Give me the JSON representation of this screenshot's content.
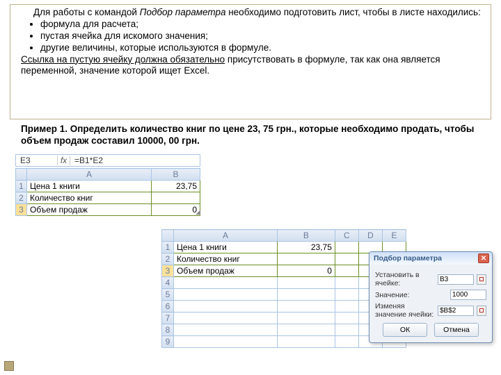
{
  "text": {
    "para1a": "Для работы с командой ",
    "para1b": "Подбор параметра",
    "para1c": " необходимо подготовить лист, чтобы в листе находились:",
    "b1": "формула для расчета;",
    "b2": "пустая ячейка для искомого значения;",
    "b3": "другие величины, которые используются в формуле.",
    "para2a": "Ссылка на пустую ячейку должна обязательно",
    "para2b": " присутствовать в формуле, так как она является переменной, значение которой ищет Excel.",
    "example": "Пример 1. Определить количество книг по цене 23, 75 грн., которые необходимо продать, чтобы объем продаж составил 10000, 00 грн."
  },
  "sheet1": {
    "activeCell": "E3",
    "formula": "=B1*E2",
    "cols": {
      "A": "A",
      "B": "B"
    },
    "rows": [
      {
        "n": "1",
        "a": "Цена 1 книги",
        "b": "23,75"
      },
      {
        "n": "2",
        "a": "Количество книг",
        "b": ""
      },
      {
        "n": "3",
        "a": "Объем продаж",
        "b": "0"
      }
    ]
  },
  "sheet2": {
    "cols": [
      "A",
      "B",
      "C",
      "D",
      "E"
    ],
    "rows": [
      {
        "n": "1",
        "a": "Цена 1 книги",
        "b": "23,75"
      },
      {
        "n": "2",
        "a": "Количество книг",
        "b": ""
      },
      {
        "n": "3",
        "a": "Объем продаж",
        "b": "0"
      },
      {
        "n": "4"
      },
      {
        "n": "5"
      },
      {
        "n": "6"
      },
      {
        "n": "7"
      },
      {
        "n": "8"
      },
      {
        "n": "9"
      }
    ]
  },
  "dialog": {
    "title": "Подбор параметра",
    "row1": "Установить в ячейке:",
    "val1": "B3",
    "row2": "Значение:",
    "val2": "1000",
    "row3": "Изменяя значение ячейки:",
    "val3": "$B$2",
    "ok": "ОК",
    "cancel": "Отмена"
  }
}
